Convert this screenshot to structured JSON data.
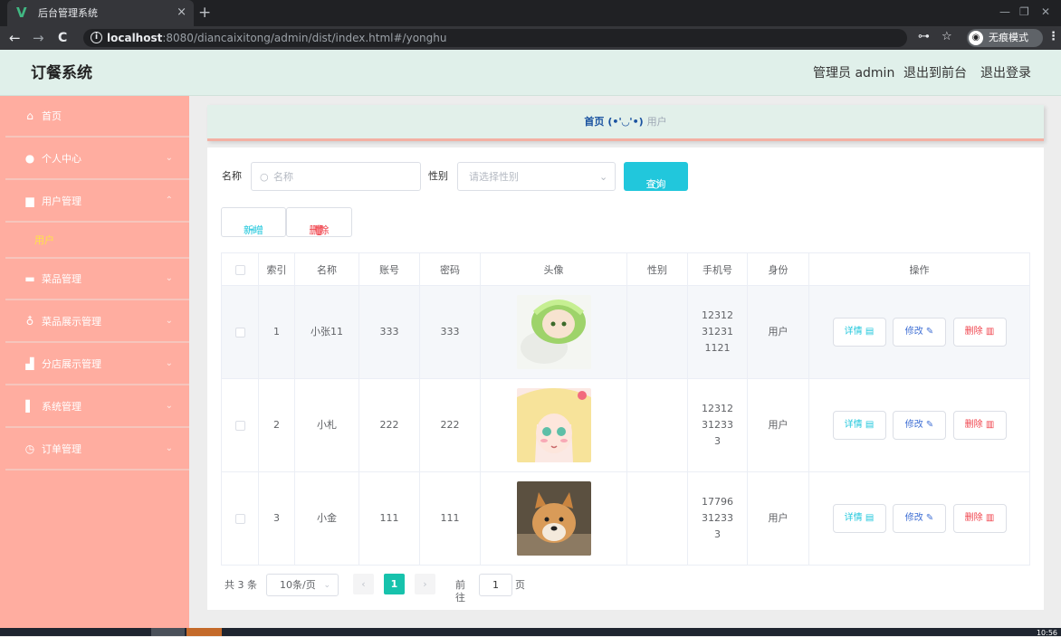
{
  "browser": {
    "tab_title": "后台管理系统",
    "tab_close": "×",
    "new_tab": "+",
    "url_host": "localhost",
    "url_rest": ":8080/diancaixitong/admin/dist/index.html#/yonghu",
    "incognito_label": "无痕模式"
  },
  "header": {
    "title": "订餐系统",
    "admin_label": "管理员 admin",
    "to_front": "退出到前台",
    "logout": "退出登录"
  },
  "sidebar": {
    "items": [
      {
        "label": "首页",
        "icon": "home-icon"
      },
      {
        "label": "个人中心",
        "icon": "user-icon"
      },
      {
        "label": "用户管理",
        "icon": "users-icon"
      },
      {
        "label": "菜品管理",
        "icon": "briefcase-icon"
      },
      {
        "label": "菜品展示管理",
        "icon": "microphone-icon"
      },
      {
        "label": "分店展示管理",
        "icon": "shop-icon"
      },
      {
        "label": "系统管理",
        "icon": "system-icon"
      },
      {
        "label": "订单管理",
        "icon": "clock-icon"
      }
    ],
    "sub_active": "用户"
  },
  "breadcrumb": {
    "home": "首页",
    "face": "(•'◡'•)",
    "current": "用户"
  },
  "search": {
    "name_label": "名称",
    "name_placeholder": "名称",
    "gender_label": "性别",
    "gender_placeholder": "请选择性别",
    "query_button": "查询"
  },
  "actions": {
    "add": "新增",
    "delete": "删除"
  },
  "table": {
    "headers": [
      "索引",
      "名称",
      "账号",
      "密码",
      "头像",
      "性别",
      "手机号",
      "身份",
      "操作"
    ],
    "rows": [
      {
        "index": "1",
        "name": "小张11",
        "account": "333",
        "password": "333",
        "gender": "",
        "phone": "12312312311121",
        "role": "用户"
      },
      {
        "index": "2",
        "name": "小札",
        "account": "222",
        "password": "222",
        "gender": "",
        "phone": "12312312333",
        "role": "用户"
      },
      {
        "index": "3",
        "name": "小金",
        "account": "111",
        "password": "111",
        "gender": "",
        "phone": "17796312333",
        "role": "用户"
      }
    ],
    "btn_detail": "详情",
    "btn_edit": "修改",
    "btn_delete": "删除"
  },
  "pager": {
    "total": "共 3 条",
    "page_size": "10条/页",
    "current": "1",
    "goto_label": "前往",
    "goto_value": "1",
    "goto_unit": "页"
  },
  "taskbar": {
    "clock": "10:56"
  },
  "colors": {
    "sidebar_bg": "#ffada0",
    "header_bg": "#e0f0ea",
    "accent": "#21c7dc",
    "pager_active": "#17c2ac",
    "submenu_active": "#ffe14a"
  }
}
